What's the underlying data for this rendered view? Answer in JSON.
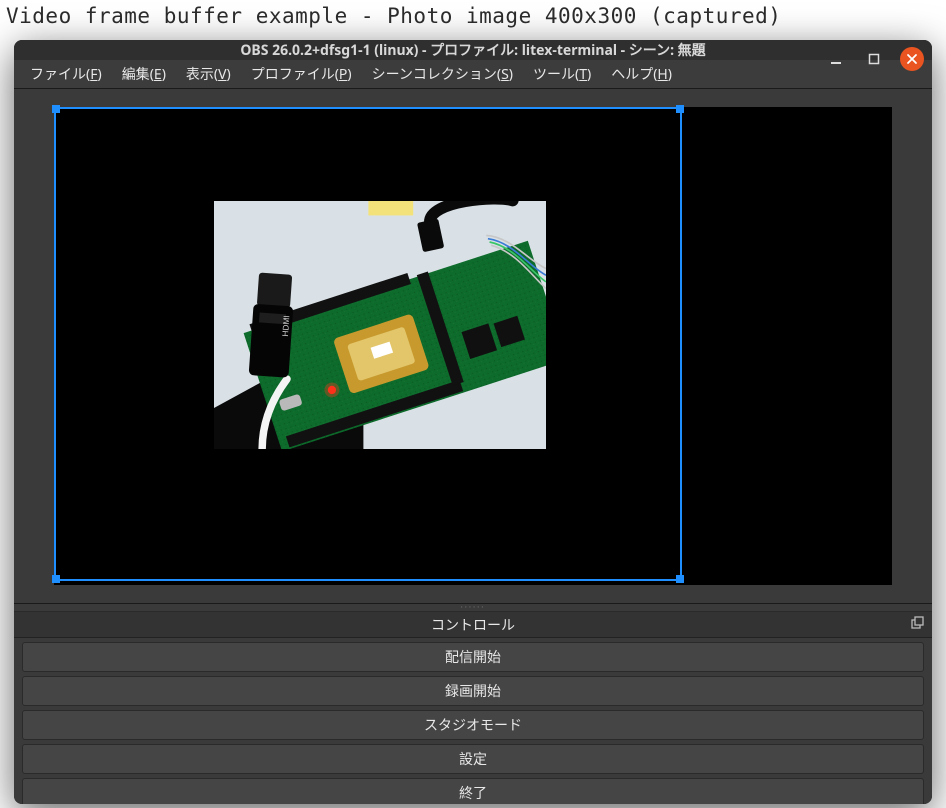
{
  "caption": "Video frame buffer example - Photo image 400x300 (captured)",
  "window": {
    "title": "OBS 26.0.2+dfsg1-1 (linux) - プロファイル: litex-terminal - シーン: 無題"
  },
  "menubar": {
    "items": [
      {
        "label": "ファイル",
        "accel": "F"
      },
      {
        "label": "編集",
        "accel": "E"
      },
      {
        "label": "表示",
        "accel": "V"
      },
      {
        "label": "プロファイル",
        "accel": "P"
      },
      {
        "label": "シーンコレクション",
        "accel": "S"
      },
      {
        "label": "ツール",
        "accel": "T"
      },
      {
        "label": "ヘルプ",
        "accel": "H"
      }
    ]
  },
  "controls": {
    "header": "コントロール",
    "buttons": [
      "配信開始",
      "録画開始",
      "スタジオモード",
      "設定",
      "終了"
    ]
  },
  "colors": {
    "accent_close": "#e95420",
    "selection_outline": "#1f8fff",
    "window_bg": "#3a3a3a",
    "titlebar_bg": "#2f2f2f"
  }
}
